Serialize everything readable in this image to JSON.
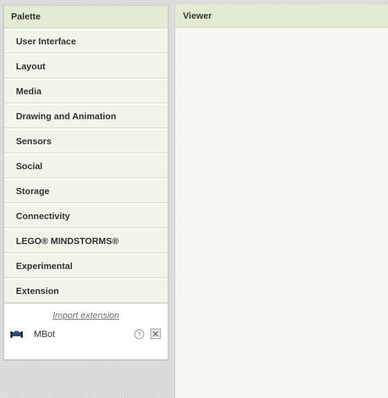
{
  "palette": {
    "title": "Palette",
    "categories": [
      "User Interface",
      "Layout",
      "Media",
      "Drawing and Animation",
      "Sensors",
      "Social",
      "Storage",
      "Connectivity",
      "LEGO® MINDSTORMS®",
      "Experimental",
      "Extension"
    ],
    "extension": {
      "import_label": "Import extension",
      "items": [
        {
          "label": "MBot",
          "icon": "mbot-robot-icon"
        }
      ],
      "help_symbol": "?"
    }
  },
  "viewer": {
    "title": "Viewer"
  },
  "colors": {
    "header_bg": "#e3ebd3",
    "category_bg": "#f1f4e9",
    "viewer_bg": "#f8f8f2"
  }
}
